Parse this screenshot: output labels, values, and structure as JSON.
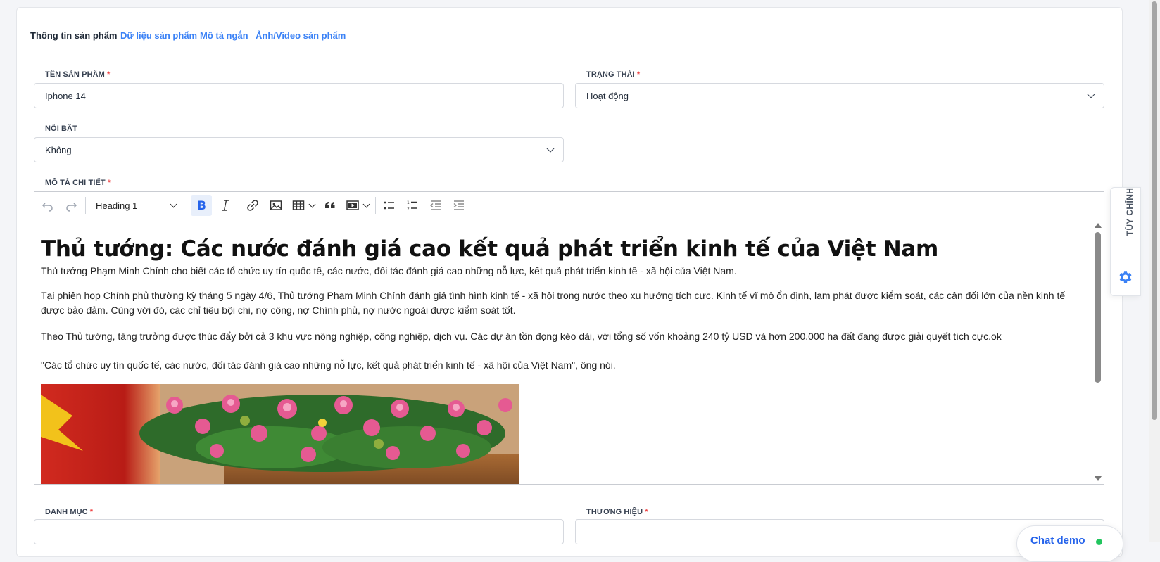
{
  "tabs": [
    {
      "label": "Thông tin sản phẩm",
      "active": true
    },
    {
      "label": "Dữ liệu sản phẩm"
    },
    {
      "label": "Mô tả ngắn"
    },
    {
      "label": "Ảnh/Video sản phẩm"
    }
  ],
  "form": {
    "name": {
      "label": "TÊN SẢN PHẨM",
      "required": "*",
      "value": "Iphone 14"
    },
    "status": {
      "label": "TRẠNG THÁI",
      "required": "*",
      "value": "Hoạt động"
    },
    "featured": {
      "label": "NỔI BẬT",
      "value": "Không"
    },
    "description": {
      "label": "MÔ TẢ CHI TIẾT",
      "required": "*"
    },
    "category": {
      "label": "DANH MỤC",
      "required": "*"
    },
    "brand": {
      "label": "THƯƠNG HIỆU",
      "required": "*"
    }
  },
  "editor": {
    "heading_select": "Heading 1",
    "content": {
      "h1": "Thủ tướng: Các nước đánh giá cao kết quả phát triển kinh tế của Việt Nam",
      "paragraphs": [
        "Thủ tướng Phạm Minh Chính cho biết các tổ chức uy tín quốc tế, các nước, đối tác đánh giá cao những nỗ lực, kết quả phát triển kinh tế - xã hội của Việt Nam.",
        "Tại phiên họp Chính phủ thường kỳ tháng 5 ngày 4/6, Thủ tướng Phạm Minh Chính đánh giá tình hình kinh tế - xã hội trong nước theo xu hướng tích cực. Kinh tế vĩ mô ổn định, lạm phát được kiểm soát, các cân đối lớn của nền kinh tế được bảo đảm. Cùng với đó, các chỉ tiêu bội chi, nợ công, nợ Chính phủ, nợ nước ngoài được kiểm soát tốt.",
        "Theo Thủ tướng, tăng trưởng được thúc đẩy bởi cả 3 khu vực nông nghiệp, công nghiệp, dịch vụ. Các dự án tồn đọng kéo dài, với tổng số vốn khoảng 240 tỷ USD và hơn 200.000 ha đất đang được giải quyết tích cực.ok",
        "\"Các tổ chức uy tín quốc tế, các nước, đối tác đánh giá cao những nỗ lực, kết quả phát triển kinh tế - xã hội của Việt Nam\", ông nói."
      ]
    }
  },
  "side_panel": {
    "label": "TÙY CHỈNH",
    "icon": "gear-icon"
  },
  "chat": {
    "label": "Chat demo"
  },
  "colors": {
    "accent": "#3b82f6",
    "required": "#ef4444",
    "online": "#22c55e"
  }
}
